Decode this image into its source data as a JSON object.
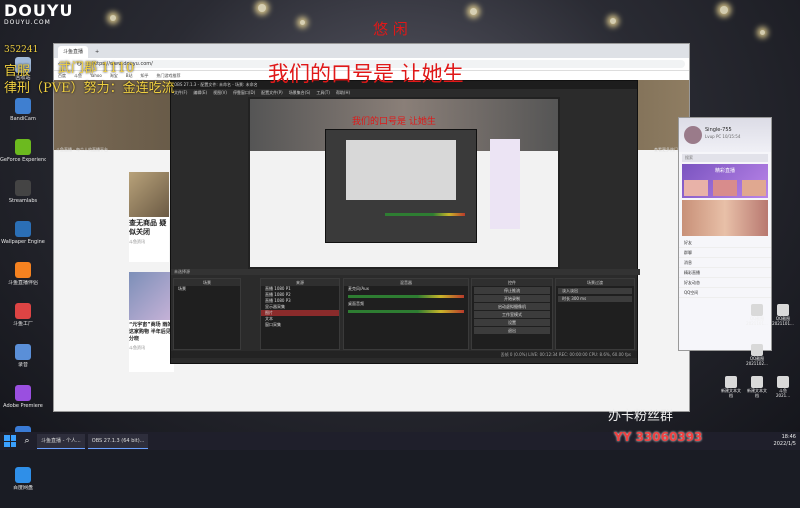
{
  "stream": {
    "platform_logo": "DOUYU",
    "platform_logo_sub": "DOUYU.COM",
    "room_id": "352241",
    "line1": "官服",
    "line1b": "武门郡  1110",
    "line2": "律刑（PVE）努力：金连吃流",
    "top_title": "悠 闲",
    "slogan": "我们的口号是 让她生",
    "slogan_small": "我们的口号是 让她生",
    "fans_group": "办卡粉丝群",
    "yy_number": "YY 33060393"
  },
  "desktop_icons": [
    {
      "label": "回收站",
      "icon": "recycle-bin-icon",
      "color": "#9fb8d8"
    },
    {
      "label": "BandiCam",
      "icon": "bandicam-icon",
      "color": "#3f7fd0"
    },
    {
      "label": "GeForce Experience",
      "icon": "geforce-icon",
      "color": "#6cba1f"
    },
    {
      "label": "Streamlabs",
      "icon": "streamlabs-icon",
      "color": "#444"
    },
    {
      "label": "Wallpaper Engine",
      "icon": "wallpaper-engine-icon",
      "color": "#2b6fb6"
    },
    {
      "label": "斗鱼直播伴侣",
      "icon": "douyu-icon",
      "color": "#f58220"
    },
    {
      "label": "斗鱼工厂",
      "icon": "factory-icon",
      "color": "#d44"
    },
    {
      "label": "录音",
      "icon": "audio-icon",
      "color": "#5a8fd8"
    },
    {
      "label": "Adobe Premiere",
      "icon": "premiere-icon",
      "color": "#9a4fe0"
    },
    {
      "label": "迅雷",
      "icon": "thunder-icon",
      "color": "#3a7bd5"
    },
    {
      "label": "百度网盘",
      "icon": "cloud-icon",
      "color": "#2f8fe8"
    }
  ],
  "browser": {
    "tabs": [
      {
        "label": "斗鱼直播",
        "active": true
      },
      {
        "label": "+",
        "active": false
      }
    ],
    "url": "https://www.douyu.com/",
    "bookmarks": [
      "百度",
      "斗鱼",
      "Yahoo",
      "淘宝",
      "B站",
      "知乎",
      "热门游戏推荐"
    ],
    "hero_caption": "斗鱼直播 - 每个人的直播平台",
    "hero_right": "查看更多热门直播",
    "cards": [
      {
        "title": "查无商品 疑似关闭",
        "meta": "斗鱼资讯"
      },
      {
        "title": "“元宇宙”商场 雨的这家购物 半年后见分晓",
        "meta": "斗鱼资讯"
      }
    ]
  },
  "obs": {
    "title": "OBS 27.1.3 - 配置文件: 未命名 - 场景: 未命名",
    "menu": [
      "文件(F)",
      "编辑(E)",
      "视图(V)",
      "停靠窗口(D)",
      "配置文件(P)",
      "场景集合(S)",
      "工具(T)",
      "帮助(H)"
    ],
    "no_source": "未选择源",
    "docks": {
      "scenes": {
        "title": "场景",
        "items": [
          "场景"
        ]
      },
      "sources": {
        "title": "来源",
        "items": [
          "直播 1080 P1",
          "直播 1080 P2",
          "直播 1080 P3",
          "显示器采集",
          "图片",
          "文本",
          "窗口采集"
        ],
        "selected": 4
      },
      "mixer": {
        "title": "混音器",
        "items": [
          "麦克风/Aux",
          "桌面音频"
        ]
      },
      "transitions": {
        "title": "场景过渡",
        "items": [
          "淡入淡出",
          "时长 300 ms"
        ]
      },
      "controls": {
        "title": "控件",
        "buttons": [
          "停止推流",
          "开始录制",
          "启动虚拟摄像机",
          "工作室模式",
          "设置",
          "退出"
        ]
      }
    },
    "status": "丢帧 0 (0.0%)  LIVE: 00:12:34  REC: 00:00:00  CPU: 8.6%, 60.00 fps"
  },
  "qq": {
    "name": "Single-755",
    "status": "Lvup PC 10/15:54",
    "search_placeholder": "搜索",
    "banner": "精彩直播",
    "items": [
      "好友",
      "群聊",
      "消息",
      "精彩直播",
      "好友动态",
      "QQ空间"
    ]
  },
  "right_files": [
    {
      "label": "QQ截图 2021101..."
    },
    {
      "label": "QQ截图 2021101..."
    },
    {
      "label": "QQ截图 2021102..."
    },
    {
      "label": "新建文本文档"
    },
    {
      "label": "新建文本文档"
    },
    {
      "label": "斗鱼 2021..."
    }
  ],
  "taskbar": {
    "items": [
      "斗鱼直播 - 个人...",
      "OBS 27.1.3 (64 bit)..."
    ],
    "time": "18:46",
    "date": "2022/1/5"
  }
}
